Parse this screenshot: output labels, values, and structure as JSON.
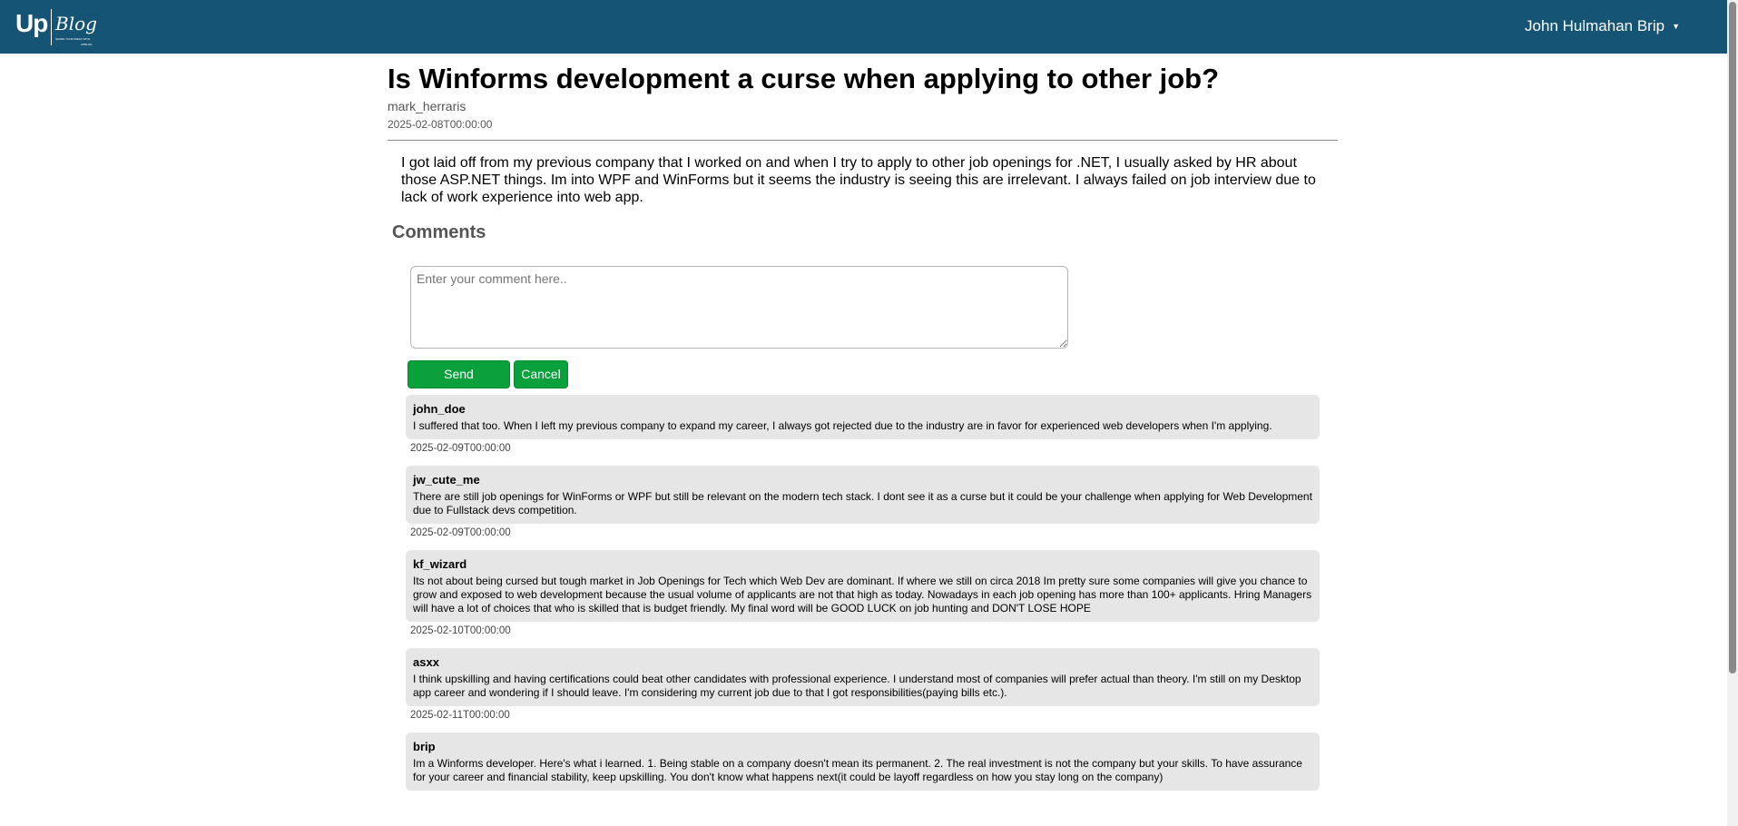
{
  "header": {
    "logo": {
      "up": "Up",
      "blog": "Blog",
      "tagline1": "SHARE YOUR IDEAS WITH",
      "tagline2": "UPBLOG"
    },
    "user_name": "John Hulmahan Brip",
    "bg_color": "#155474"
  },
  "post": {
    "title": "Is Winforms development a curse when applying to other job?",
    "author": "mark_herraris",
    "date": "2025-02-08T00:00:00",
    "body": "I got laid off from my previous company that I worked on and when I try to apply to other job openings for .NET, I usually asked by HR about those ASP.NET things. Im into WPF and WinForms but it seems the industry is seeing this are irrelevant. I always failed on job interview due to lack of work experience into web app."
  },
  "comments_section": {
    "heading": "Comments",
    "input_placeholder": "Enter your comment here..",
    "send_label": "Send Comment",
    "cancel_label": "Cancel",
    "button_color": "#0aa13c",
    "items": [
      {
        "user": "john_doe",
        "text": "I suffered that too. When I left my previous company to expand my career, I always got rejected due to the industry are in favor for experienced web developers when I'm applying.",
        "date": "2025-02-09T00:00:00"
      },
      {
        "user": "jw_cute_me",
        "text": "There are still job openings for WinForms or WPF but still be relevant on the modern tech stack. I dont see it as a curse but it could be your challenge when applying for Web Development due to Fullstack devs competition.",
        "date": "2025-02-09T00:00:00"
      },
      {
        "user": "kf_wizard",
        "text": "Its not about being cursed but tough market in Job Openings for Tech which Web Dev are dominant. If where we still on circa 2018 Im pretty sure some companies will give you chance to grow and exposed to web development because the usual volume of applicants are not that high as today. Nowadays in each job opening has more than 100+ applicants. Hring Managers will have a lot of choices that who is skilled that is budget friendly. My final word will be GOOD LUCK on job hunting and DON'T LOSE HOPE",
        "date": "2025-02-10T00:00:00"
      },
      {
        "user": "asxx",
        "text": "I think upskilling and having certifications could beat other candidates with professional experience. I understand most of companies will prefer actual than theory. I'm still on my Desktop app career and wondering if I should leave. I'm considering my current job due to that I got responsibilities(paying bills etc.).",
        "date": "2025-02-11T00:00:00"
      },
      {
        "user": "brip",
        "text": "Im a Winforms developer. Here's what i learned. 1. Being stable on a company doesn't mean its permanent. 2. The real investment is not the company but your skills. To have assurance for your career and financial stability, keep upskilling. You don't know what happens next(it could be layoff regardless on how you stay long on the company)",
        "date": ""
      }
    ]
  }
}
